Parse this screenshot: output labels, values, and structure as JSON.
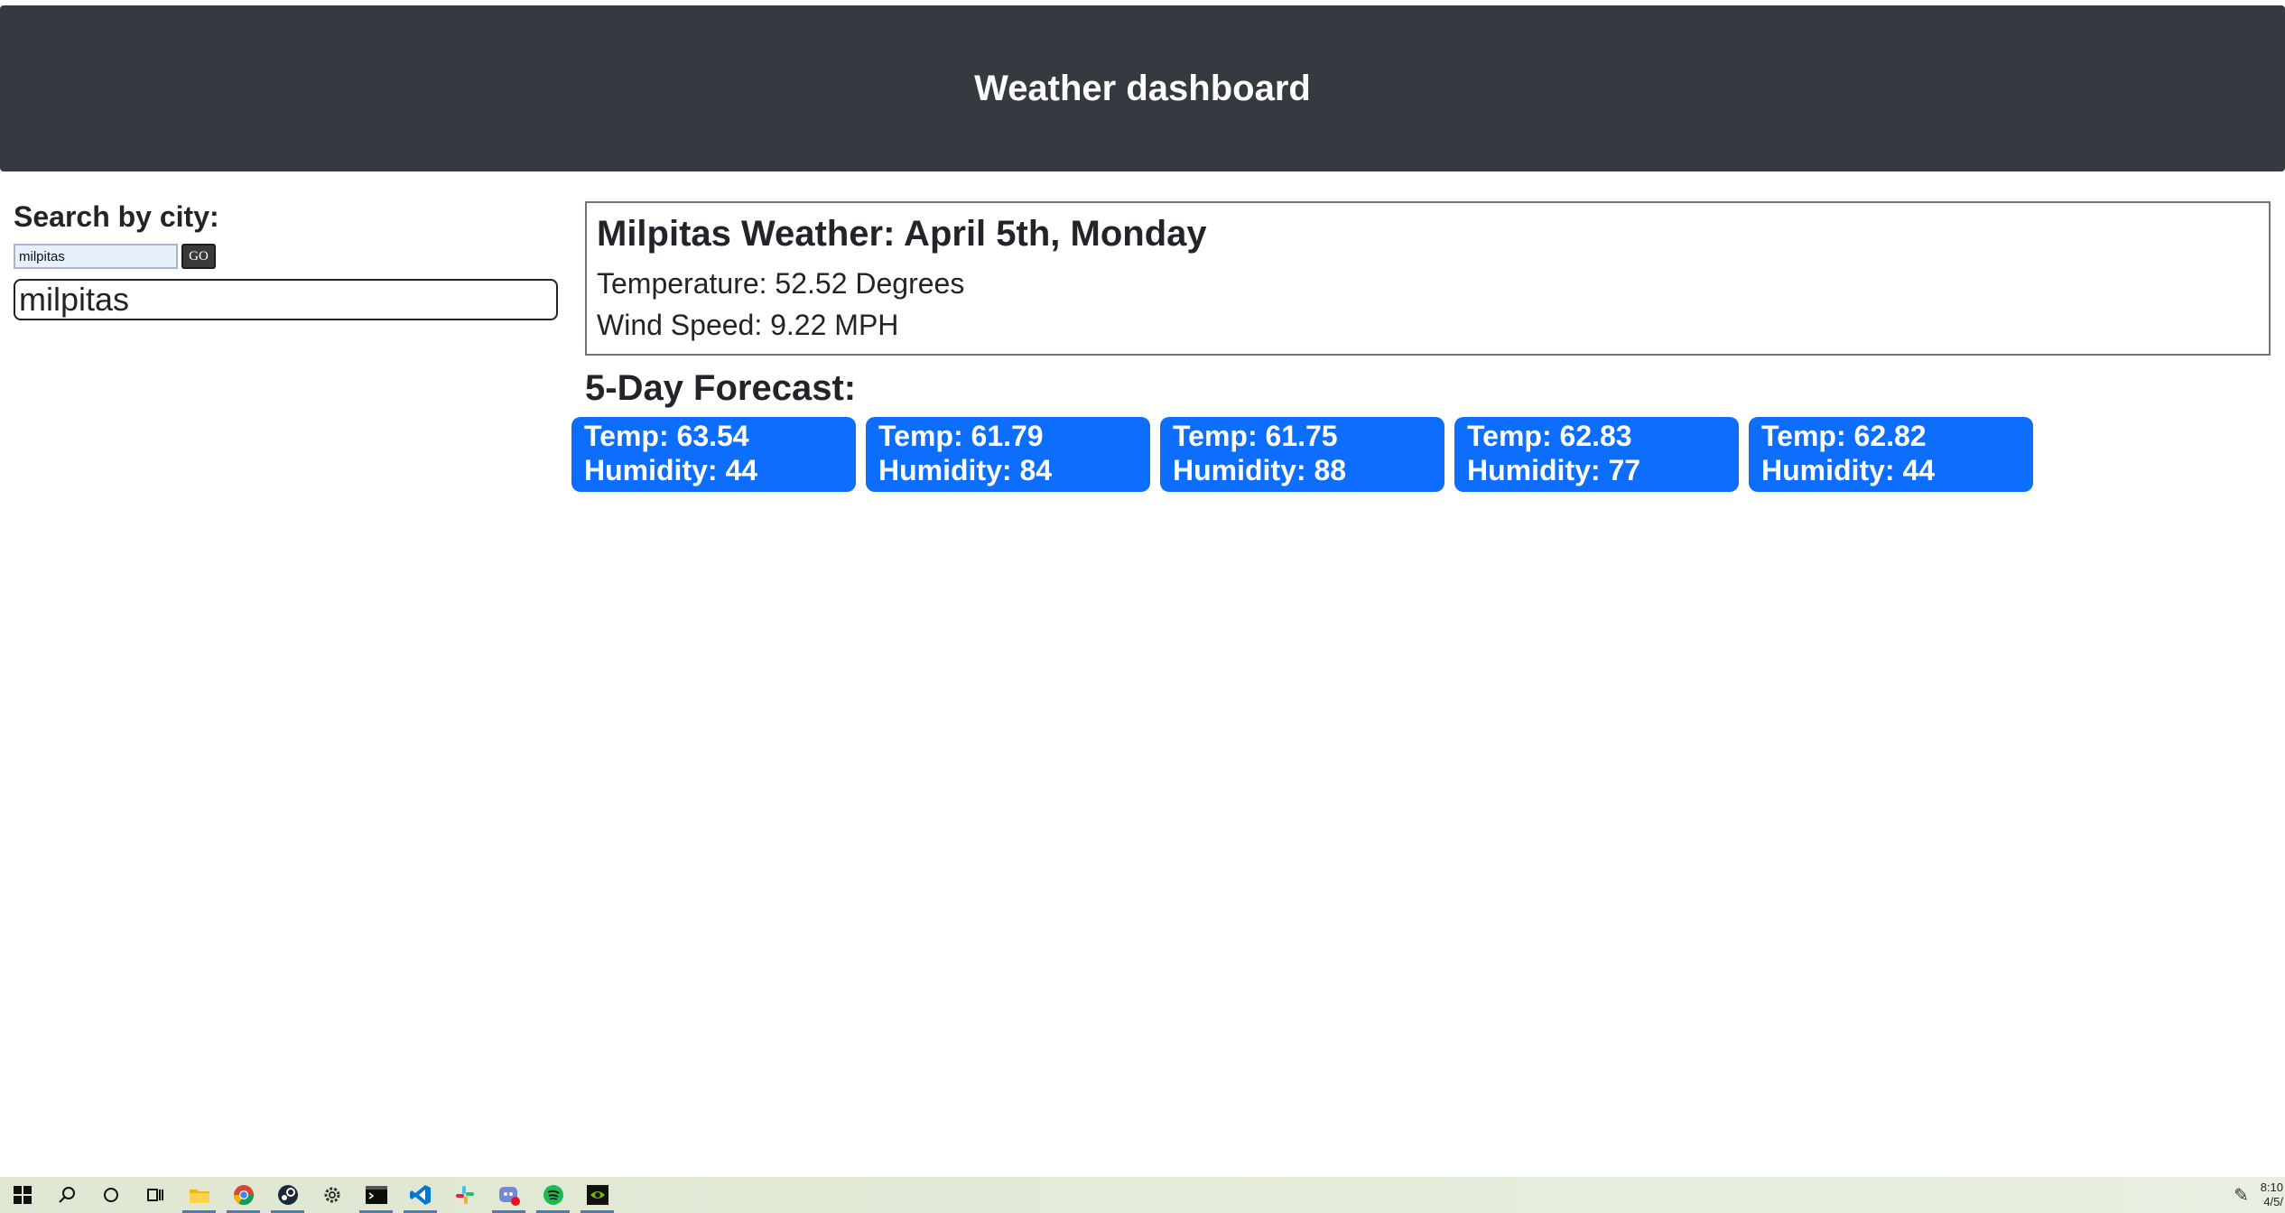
{
  "header": {
    "title": "Weather dashboard"
  },
  "search": {
    "label": "Search by city:",
    "input_value": "milpitas",
    "go_label": "GO",
    "history": [
      "milpitas"
    ]
  },
  "current": {
    "title": "Milpitas Weather: April 5th, Monday",
    "temperature": "Temperature: 52.52 Degrees",
    "wind": "Wind Speed: 9.22 MPH"
  },
  "forecast": {
    "title": "5-Day Forecast:",
    "days": [
      {
        "temp": "Temp: 63.54",
        "humidity": "Humidity: 44"
      },
      {
        "temp": "Temp: 61.79",
        "humidity": "Humidity: 84"
      },
      {
        "temp": "Temp: 61.75",
        "humidity": "Humidity: 88"
      },
      {
        "temp": "Temp: 62.83",
        "humidity": "Humidity: 77"
      },
      {
        "temp": "Temp: 62.82",
        "humidity": "Humidity: 44"
      }
    ]
  },
  "taskbar": {
    "apps": [
      {
        "name": "start-icon",
        "color": "#1a1a1a"
      },
      {
        "name": "search-icon",
        "color": "#1a1a1a"
      },
      {
        "name": "cortana-icon",
        "color": "#1a1a1a"
      },
      {
        "name": "task-view-icon",
        "color": "#1a1a1a"
      },
      {
        "name": "file-explorer-icon",
        "color": "#f2b418"
      },
      {
        "name": "chrome-icon",
        "color": "#db4437"
      },
      {
        "name": "steam-icon",
        "color": "#1b2838"
      },
      {
        "name": "settings-icon",
        "color": "#333333"
      },
      {
        "name": "terminal-icon",
        "color": "#0c0c0c"
      },
      {
        "name": "vscode-icon",
        "color": "#0078d7"
      },
      {
        "name": "slack-icon",
        "color": "#e01e5a"
      },
      {
        "name": "discord-icon",
        "color": "#7289da"
      },
      {
        "name": "spotify-icon",
        "color": "#1db954"
      },
      {
        "name": "nvidia-icon",
        "color": "#76b900"
      }
    ],
    "clock_time": "8:10",
    "clock_date": "4/5/"
  }
}
